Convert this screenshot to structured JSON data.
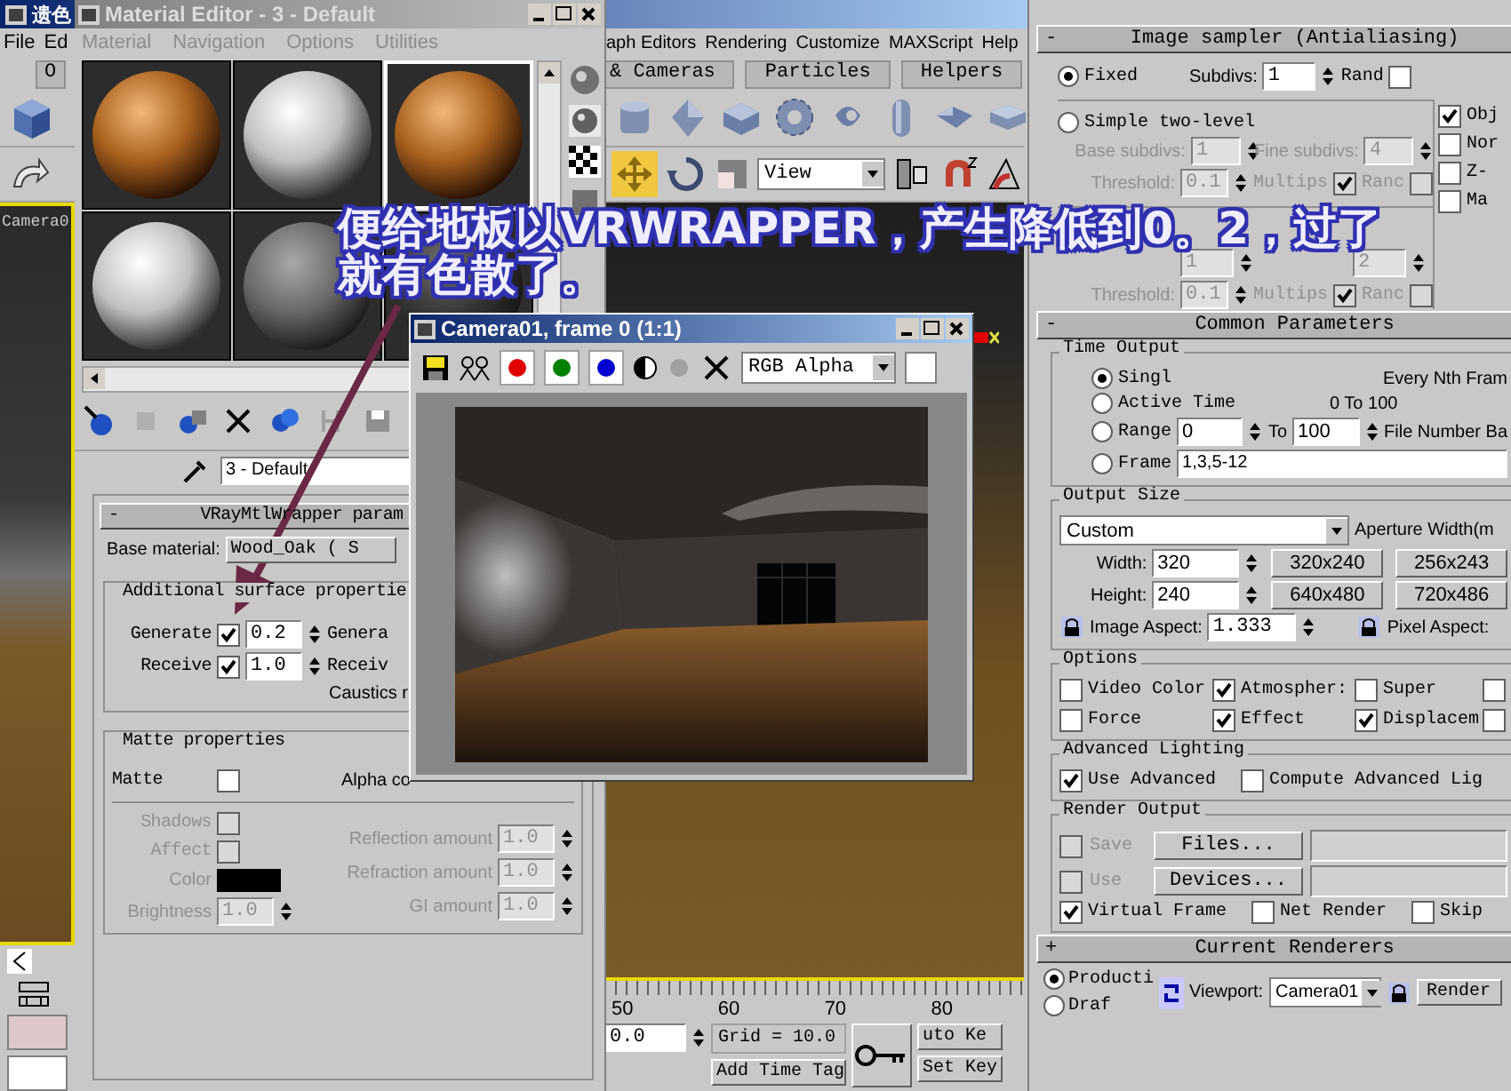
{
  "main_window": {
    "title": "遗色",
    "menu_left": [
      "File",
      "Ed"
    ],
    "menu_right": [
      "aph Editors",
      "Rendering",
      "Customize",
      "MAXScript",
      "Help"
    ],
    "tab_fragment": "O",
    "command_tabs": [
      {
        "label": "& Cameras",
        "selected": false
      },
      {
        "label": "Particles",
        "selected": false
      },
      {
        "label": "Helpers",
        "selected": false
      }
    ],
    "view_dropdown": "View",
    "viewport_label": "Camera0",
    "timeline_ticks": [
      "50",
      "60",
      "70",
      "80"
    ],
    "frame_field": "0.0",
    "grid_readout": "Grid = 10.0",
    "time_tag_button": "Add Time Tag",
    "auto_key_button": "uto Ke",
    "set_key_button": "Set Key"
  },
  "material_editor": {
    "title": "Material Editor - 3 - Default",
    "menu": [
      "Material",
      "Navigation",
      "Options",
      "Utilities"
    ],
    "slots": [
      {
        "kind": "wood",
        "selected": false
      },
      {
        "kind": "white",
        "selected": false
      },
      {
        "kind": "wood",
        "selected": true
      },
      {
        "kind": "white",
        "selected": false
      },
      {
        "kind": "gray",
        "selected": false
      },
      {
        "kind": "dark",
        "selected": false
      }
    ],
    "name_field": "3 - Default",
    "rollout_sign": "-",
    "rollout_title": "VRayMtlWrapper param",
    "base_material_label": "Base material:",
    "base_material_button": "Wood_Oak  ( S",
    "surface_group": "Additional surface propertie",
    "surface_rows": [
      {
        "label": "Generate",
        "checked": true,
        "value": "0.2",
        "extra": "Genera"
      },
      {
        "label": "Receive",
        "checked": true,
        "value": "1.0",
        "extra": "Receiv"
      }
    ],
    "caustics_label": "Caustics r",
    "matte_group": "Matte properties",
    "matte": {
      "label": "Matte",
      "checked": false
    },
    "alpha_label": "Alpha co",
    "shadows": {
      "label": "Shadows",
      "checked": false
    },
    "affect": {
      "label": "Affect",
      "checked": false
    },
    "color_label": "Color",
    "brightness_label": "Brightness",
    "brightness_value": "1.0",
    "amounts": [
      {
        "label": "Reflection amount",
        "value": "1.0"
      },
      {
        "label": "Refraction amount",
        "value": "1.0"
      },
      {
        "label": "GI amount",
        "value": "1.0"
      }
    ]
  },
  "frame_window": {
    "title": "Camera01, frame 0 (1:1)",
    "channel_buttons": [
      {
        "color": "#e00000"
      },
      {
        "color": "#008000"
      },
      {
        "color": "#0000d0"
      }
    ],
    "channel_dropdown": "RGB Alpha"
  },
  "render_dialog": {
    "sampler": {
      "sign": "-",
      "title": "Image sampler (Antialiasing)",
      "types": [
        {
          "label": "Fixed",
          "selected": true
        },
        {
          "label": "Simple two-level",
          "selected": false
        }
      ],
      "subdivs_label": "Subdivs:",
      "subdivs": "1",
      "rand_label": "Rand",
      "rand_checked": false,
      "groups": [
        {
          "fields": [
            {
              "label": "Base subdivs:",
              "value": "1"
            },
            {
              "label": "Fine subdivs:",
              "value": "4"
            }
          ],
          "threshold_label": "Threshold:",
          "threshold": "0.1",
          "multips_label": "Multips",
          "multips_checked": true,
          "ranc_label": "Ranc",
          "ranc_checked": false
        },
        {
          "fields": [
            {
              "value": "1"
            },
            {
              "value": "2"
            }
          ],
          "threshold_label": "Threshold:",
          "threshold": "0.1",
          "multips_label": "Multips",
          "multips_checked": true,
          "ranc_label": "Ranc",
          "ranc_checked": false
        }
      ],
      "side_options": [
        {
          "label": "Obj",
          "checked": true
        },
        {
          "label": "Nor",
          "checked": false
        },
        {
          "label": "Z-",
          "checked": false
        },
        {
          "label": "Ma",
          "checked": false
        }
      ]
    },
    "common": {
      "sign": "-",
      "title": "Common Parameters"
    },
    "time_output": {
      "title": "Time Output",
      "options": [
        {
          "kind": "note",
          "label": "Singl",
          "selected": true,
          "right_note": "Every Nth Fram"
        },
        {
          "kind": "note",
          "label": "Active Time",
          "selected": false,
          "note": "0 To 100"
        },
        {
          "kind": "range",
          "label": "Range",
          "selected": false,
          "from": "0",
          "to_label": "To",
          "to": "100",
          "right_note": "File Number Ba"
        },
        {
          "kind": "list",
          "label": "Frame",
          "selected": false,
          "value": "1,3,5-12"
        }
      ]
    },
    "output_size": {
      "title": "Output Size",
      "preset": "Custom",
      "aperture_label": "Aperture Width(m",
      "dims": [
        {
          "label": "Width:",
          "value": "320"
        },
        {
          "label": "Height:",
          "value": "240"
        }
      ],
      "presets": [
        "320x240",
        "256x243",
        "640x480",
        "720x486"
      ],
      "image_aspect_label": "Image Aspect:",
      "image_aspect": "1.333",
      "pixel_aspect_label": "Pixel Aspect:"
    },
    "options": {
      "title": "Options",
      "items": [
        {
          "label": "Video Color",
          "checked": false
        },
        {
          "label": "Atmospher:",
          "checked": true
        },
        {
          "label": "Super",
          "checked": false
        },
        {
          "checked": false
        },
        {
          "label": "Force",
          "checked": false
        },
        {
          "label": "Effect",
          "checked": true
        },
        {
          "label": "Displacem",
          "checked": true
        },
        {
          "checked": false
        }
      ]
    },
    "advanced_lighting": {
      "title": "Advanced Lighting",
      "items": [
        {
          "label": "Use Advanced",
          "checked": true
        },
        {
          "label": "Compute Advanced Lig",
          "checked": false
        }
      ]
    },
    "render_output": {
      "title": "Render Output",
      "save": {
        "label": "Save",
        "checked": false
      },
      "files_button": "Files...",
      "use": {
        "label": "Use",
        "checked": false
      },
      "devices_button": "Devices...",
      "flags": [
        {
          "label": "Virtual Frame",
          "checked": true
        },
        {
          "label": "Net Render",
          "checked": false
        },
        {
          "label": "Skip",
          "checked": false
        }
      ]
    },
    "renderers": {
      "sign": "+",
      "title": "Current Renderers"
    },
    "bottom": {
      "modes": [
        {
          "label": "Producti",
          "selected": true
        },
        {
          "label": "Draf",
          "selected": false
        }
      ],
      "viewport_label": "Viewport:",
      "viewport": "Camera01",
      "render_button": "Render"
    }
  },
  "annotation": {
    "lines": [
      "便给地板以VRWRAPPER，产生降低到0。2，过了",
      "就有色散了。"
    ]
  }
}
